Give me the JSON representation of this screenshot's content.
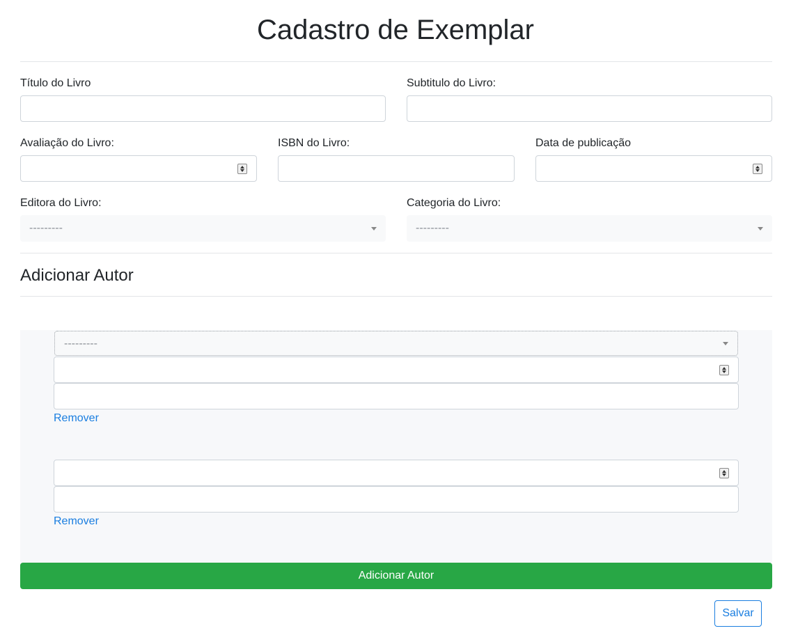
{
  "page": {
    "title": "Cadastro de Exemplar"
  },
  "form": {
    "titulo_label": "Título do Livro",
    "subtitulo_label": "Subtitulo do Livro:",
    "avaliacao_label": "Avaliação do Livro:",
    "isbn_label": "ISBN do Livro:",
    "data_label": "Data de publicação",
    "editora_label": "Editora do Livro:",
    "editora_value": "---------",
    "categoria_label": "Categoria do Livro:",
    "categoria_value": "---------"
  },
  "authors": {
    "section_title": "Adicionar Autor",
    "entry1_select_value": "---------",
    "remove_label": "Remover",
    "add_button_label": "Adicionar Autor"
  },
  "actions": {
    "save_label": "Salvar"
  },
  "icons": {
    "spinner": "number-spinner-icon",
    "caret": "caret-down-icon"
  },
  "colors": {
    "success": "#28a745",
    "primary": "#1a7ee0",
    "select_bg": "#f8f9fa"
  }
}
